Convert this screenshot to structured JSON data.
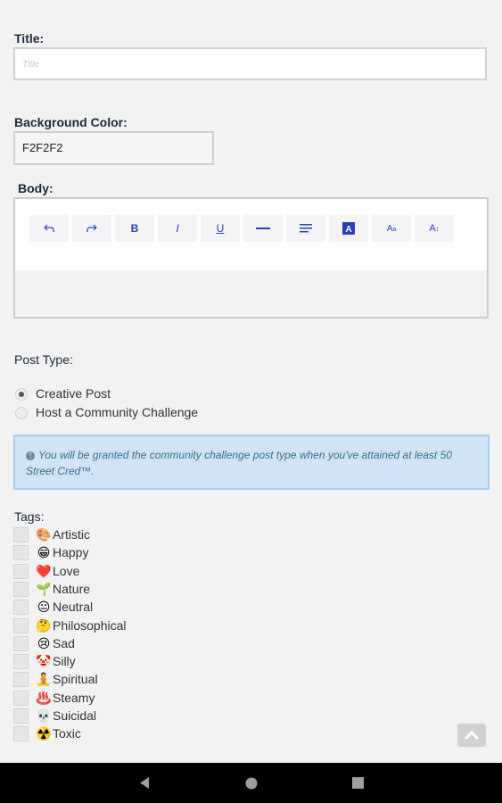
{
  "form": {
    "title_label": "Title:",
    "title_placeholder": "Title",
    "bg_label": "Background Color:",
    "bg_value": "F2F2F2",
    "body_label": "Body:",
    "toolbar": [
      {
        "name": "undo-icon",
        "glyph": "↶"
      },
      {
        "name": "redo-icon",
        "glyph": "↷"
      },
      {
        "name": "bold-icon",
        "glyph": "B"
      },
      {
        "name": "italic-icon",
        "glyph": "I"
      },
      {
        "name": "underline-icon",
        "glyph": "U"
      },
      {
        "name": "horizontal-rule-icon",
        "glyph": "—"
      },
      {
        "name": "align-icon",
        "glyph": "≡"
      },
      {
        "name": "text-color-icon",
        "glyph": "A"
      },
      {
        "name": "font-size-down-icon",
        "glyph": "A"
      },
      {
        "name": "font-size-up-icon",
        "glyph": "A"
      }
    ],
    "post_type_label": "Post Type:",
    "post_types": [
      {
        "label": "Creative Post",
        "selected": true
      },
      {
        "label": "Host a Community Challenge",
        "selected": false
      }
    ],
    "notice": "You will be granted the community challenge post type when you've attained at least 50 Street Cred™.",
    "tags_label": "Tags:",
    "tags": [
      {
        "emoji": "🎨",
        "label": "Artistic"
      },
      {
        "emoji": "😁",
        "label": "Happy"
      },
      {
        "emoji": "❤️",
        "label": "Love"
      },
      {
        "emoji": "🌱",
        "label": "Nature"
      },
      {
        "emoji": "😐",
        "label": "Neutral"
      },
      {
        "emoji": "🤔",
        "label": "Philosophical"
      },
      {
        "emoji": "😢",
        "label": "Sad"
      },
      {
        "emoji": "🤡",
        "label": "Silly"
      },
      {
        "emoji": "🧘",
        "label": "Spiritual"
      },
      {
        "emoji": "♨️",
        "label": "Steamy"
      },
      {
        "emoji": "💀",
        "label": "Suicidal"
      },
      {
        "emoji": "☢️",
        "label": "Toxic"
      }
    ]
  },
  "colors": {
    "accent": "#2a3fbf",
    "notice_bg": "#cfe4f7",
    "page_bg": "#f2f2f2"
  }
}
